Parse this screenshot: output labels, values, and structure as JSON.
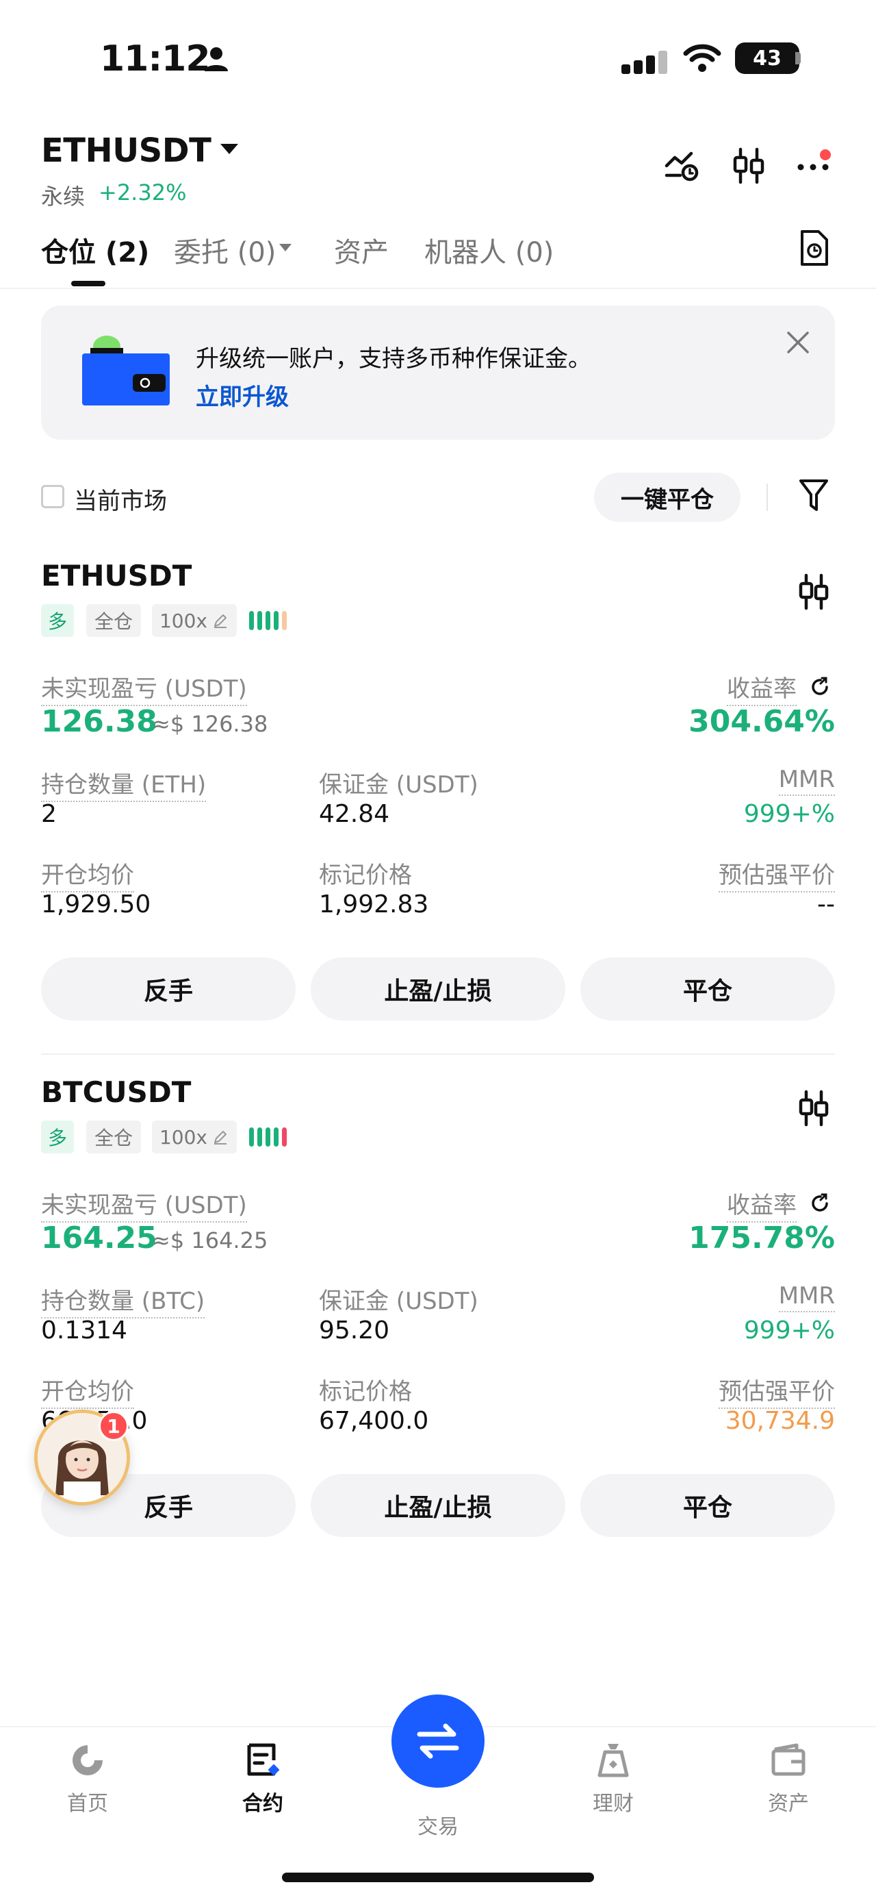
{
  "status_bar": {
    "time": "11:12",
    "battery": "43"
  },
  "header": {
    "pair": "ETHUSDT",
    "subtitle": "永续",
    "change": "+2.32%"
  },
  "tabs": [
    {
      "label": "仓位 (2)",
      "active": true
    },
    {
      "label": "委托 (0)",
      "active": false
    },
    {
      "label": "资产",
      "active": false
    },
    {
      "label": "机器人 (0)",
      "active": false
    }
  ],
  "banner": {
    "text": "升级统一账户，支持多币种作保证金。",
    "link": "立即升级"
  },
  "filters": {
    "current_market": "当前市场",
    "close_all": "一键平仓"
  },
  "positions": [
    {
      "symbol": "ETHUSDT",
      "side": "多",
      "margin_mode": "全仓",
      "leverage": "100x",
      "risk_level": 4,
      "unrealized_label": "未实现盈亏 (USDT)",
      "unrealized": "126.38",
      "unrealized_approx": "≈$ 126.38",
      "roe_label": "收益率",
      "roe": "304.64%",
      "qty_label": "持仓数量 (ETH)",
      "qty": "2",
      "margin_label": "保证金 (USDT)",
      "margin": "42.84",
      "mmr_label": "MMR",
      "mmr": "999+%",
      "entry_label": "开仓均价",
      "entry": "1,929.50",
      "mark_label": "标记价格",
      "mark": "1,992.83",
      "liq_label": "预估强平价",
      "liq": "--",
      "btn_reverse": "反手",
      "btn_tpsl": "止盈/止损",
      "btn_close": "平仓"
    },
    {
      "symbol": "BTCUSDT",
      "side": "多",
      "margin_mode": "全仓",
      "leverage": "100x",
      "risk_level": 5,
      "unrealized_label": "未实现盈亏 (USDT)",
      "unrealized": "164.25",
      "unrealized_approx": "≈$ 164.25",
      "roe_label": "收益率",
      "roe": "175.78%",
      "qty_label": "持仓数量 (BTC)",
      "qty": "0.1314",
      "margin_label": "保证金 (USDT)",
      "margin": "95.20",
      "mmr_label": "MMR",
      "mmr": "999+%",
      "entry_label": "开仓均价",
      "entry": "66,15_.0",
      "mark_label": "标记价格",
      "mark": "67,400.0",
      "liq_label": "预估强平价",
      "liq": "30,734.9",
      "btn_reverse": "反手",
      "btn_tpsl": "止盈/止损",
      "btn_close": "平仓"
    }
  ],
  "support_badge": "1",
  "bottom_nav": [
    {
      "label": "首页",
      "icon": "home-icon",
      "active": false
    },
    {
      "label": "合约",
      "icon": "contract-icon",
      "active": true
    },
    {
      "label": "交易",
      "icon": "swap-icon",
      "active": false
    },
    {
      "label": "理财",
      "icon": "finance-icon",
      "active": false
    },
    {
      "label": "资产",
      "icon": "wallet-icon",
      "active": false
    }
  ],
  "colors": {
    "green": "#1bb07a",
    "orange": "#f29b4b",
    "accent_blue": "#1a5cff",
    "link_blue": "#0b57d0"
  }
}
